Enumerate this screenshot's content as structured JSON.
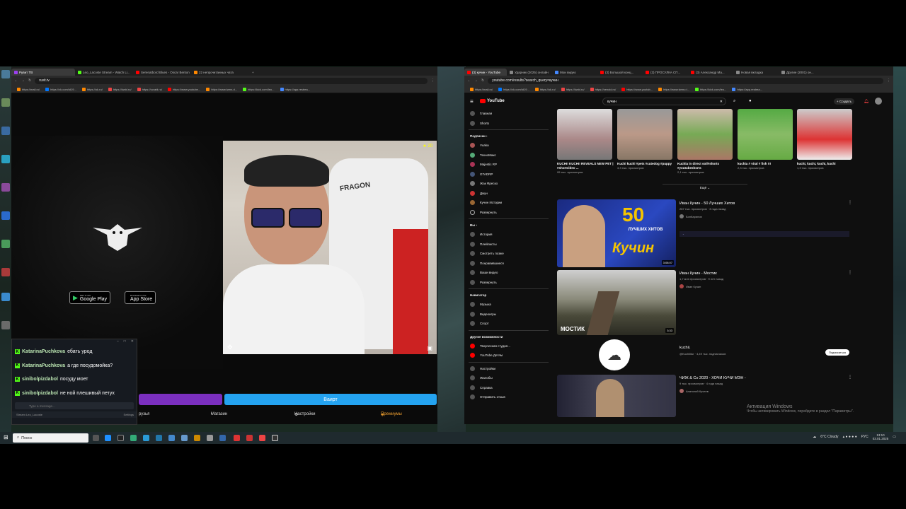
{
  "left_browser": {
    "tabs": [
      "Рувит ТВ",
      "Leo_Lacoste Stream - Watch Li...",
      "Serenatbord Blues - Oscar Benton",
      "22 непрочитанных чата"
    ],
    "url": "ruvit.tv",
    "bookmarks": [
      "https://mail.ru/",
      "https://vk.com/id19...",
      "https://ok.ru/",
      "https://kwid.ru/",
      "https://ccrabl.ru/",
      "https://www.youtube...",
      "https://www.twrnu.t...",
      "https://kick.com/leo...",
      "https://app.restrea...",
      "https://zenho.cn/..."
    ]
  },
  "ruvit": {
    "google_play": {
      "small": "GET IT ON",
      "label": "Google Play"
    },
    "app_store": {
      "small": "Download on the",
      "label": "App Store"
    },
    "blue_button": "Ваирт",
    "menu": {
      "friends": "рузья",
      "shop": "Магазин",
      "settings": "Настройки",
      "premium": "Премиумы"
    },
    "stream_badge": "20"
  },
  "chat": {
    "messages": [
      {
        "user": "KatarinaPuchkova",
        "text": "ебать урод"
      },
      {
        "user": "KatarinaPuchkova",
        "text": "а где посудомойка?"
      },
      {
        "user": "sinibolpizdabol",
        "text": "посуду моет"
      },
      {
        "user": "sinibolpizdabol",
        "text": "не ной плешивый петух"
      }
    ],
    "input_placeholder": "Type a message...",
    "footer_channel": "Stream Leo_Lacoste",
    "footer_settings": "Settings"
  },
  "right_browser": {
    "tabs": [
      "(3) кучин - YouTube",
      "Ударник (2025) онлайн",
      "Мои видео",
      "(3) Большой конц...",
      "(3) ПРОСУЛКА СП...",
      "(3) Александр Ма...",
      "Новая вкладка",
      "Другие (2001) он..."
    ],
    "url": "youtube.com/results?search_query=кучин",
    "bookmarks": [
      "https://mail.ru/",
      "https://vk.com/id19...",
      "https://ok.ru/",
      "https://kwid.ru/",
      "https://zenoid.ru/",
      "https://www.youtub...",
      "https://www.twrnu.t...",
      "https://kick.com/leo...",
      "https://app.restrea...",
      "https://zetrino.md/..."
    ]
  },
  "youtube": {
    "logo": "YouTube",
    "search_query": "кучин",
    "create_label": "Создать",
    "sidebar_main": [
      "Главная",
      "Shorts"
    ],
    "subs_header": "Подписки",
    "subs": [
      "Vuaka",
      "ТехноМакс",
      "Majestic RP",
      "GTADRP",
      "Жак Фреско",
      "Джун",
      "Кучин Истории",
      "Развернуть"
    ],
    "you_header": "Вы",
    "you_items": [
      "История",
      "Плейлисты",
      "Смотреть позже",
      "Понравившиеся",
      "Ваши видео",
      "Развернуть"
    ],
    "nav_header": "Навигатор",
    "nav_items": [
      "Музыка",
      "Видеоигры",
      "Спорт"
    ],
    "other_header": "Другие возможности",
    "other_items": [
      "Творческая студия...",
      "YouTube Детям"
    ],
    "bottom_items": [
      "Настройки",
      "Жалобы",
      "Справка",
      "Отправить отзыв"
    ],
    "shorts": [
      {
        "title": "KUCHI! KUCHI! REVEALS NEW PET | #shortvideo ...",
        "meta": "95 тыс. просмотров"
      },
      {
        "title": "Kuchi kuchi #pets #cutedog #puppy",
        "meta": "3,3 тыс. просмотров"
      },
      {
        "title": "Kuchia in direct soil#shorts #youtubeshorts",
        "meta": "2,1 тыс. просмотров"
      },
      {
        "title": "kuchia # viral # fish !!!",
        "meta": "2,3 тыс. просмотров"
      },
      {
        "title": "kuchi, kuchi, kuchi, kuchi",
        "meta": "1,3 тыс. просмотров"
      }
    ],
    "show_more": "Ещё",
    "videos": [
      {
        "title": "Иван Кучин - 50 Лучших Хитов",
        "meta": "267 тыс. просмотров · 3 года назад",
        "channel": "БонКаринов",
        "duration": "3:08:07",
        "thumb_big": "50",
        "thumb_sub": "ЛУЧШИХ ХИТОВ",
        "thumb_name": "Кучин"
      },
      {
        "title": "Иван Кучин - Мостик",
        "meta": "1,7 млн просмотров · 9 лет назад",
        "channel": "Иван Кучин",
        "duration": "3:33",
        "thumb_name": "МОСТИК"
      },
      {
        "title": "kuchii.",
        "meta": "@Kuchiiitur · 4,49 тыс. подписчиков",
        "channel": "",
        "subscribe": "Подписаться"
      },
      {
        "title": "ЧИЖ & Co 2020 - ХОЧИ КУЧИ МЭН -",
        "meta": "9 тыс. просмотров · 4 года назад",
        "channel": "Анатолий Кучеев"
      }
    ]
  },
  "windows": {
    "activate_title": "Активация Windows",
    "activate_sub": "Чтобы активировать Windows, перейдите в раздел \"Параметры\".",
    "search_placeholder": "Поиск",
    "weather": "6°C  Cloudy",
    "lang": "РУС",
    "time": "13:10",
    "date": "03.01.2025"
  }
}
